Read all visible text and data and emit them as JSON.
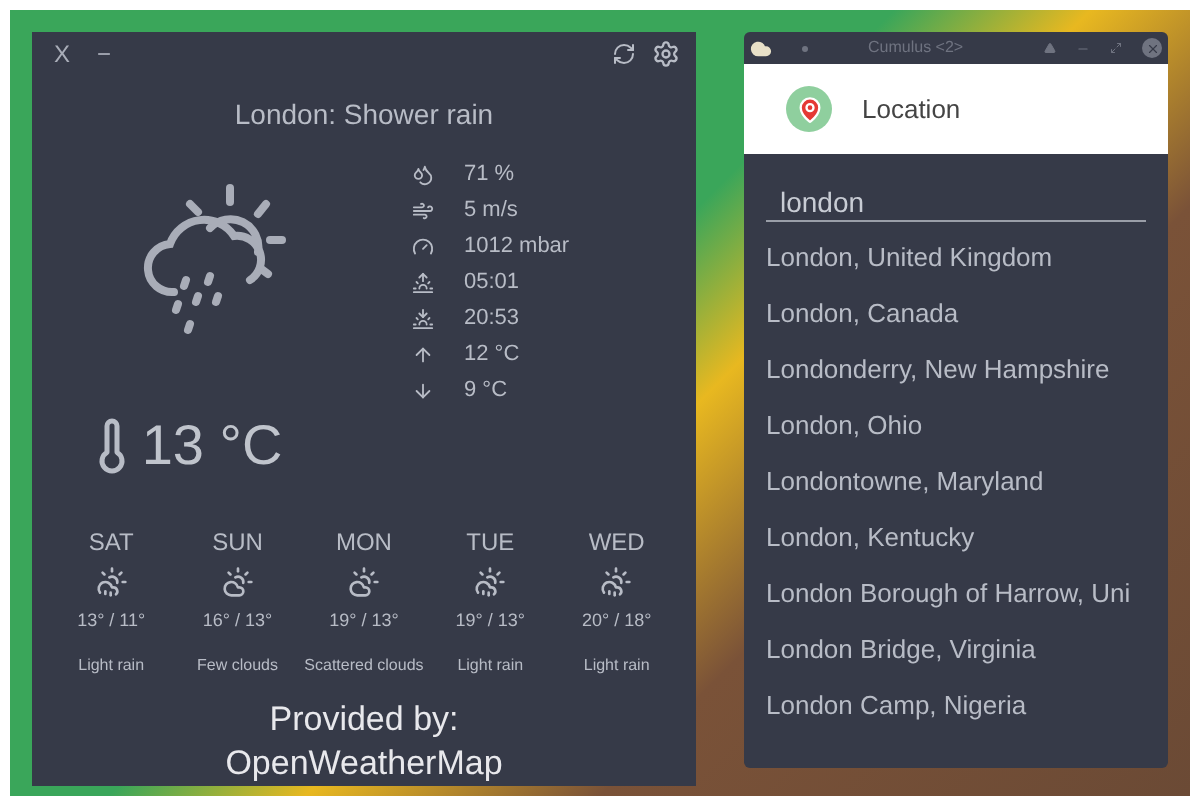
{
  "weather_window": {
    "close_label": "X",
    "minimize_label": "−",
    "title": "London: Shower rain",
    "weather_icon": {
      "kind": "rain"
    },
    "details": [
      {
        "kind": "humidity",
        "value": "71 %"
      },
      {
        "kind": "wind",
        "value": "5 m/s"
      },
      {
        "kind": "pressure",
        "value": "1012 mbar"
      },
      {
        "kind": "sunrise",
        "value": "05:01"
      },
      {
        "kind": "sunset",
        "value": "20:53"
      },
      {
        "kind": "high",
        "value": "12 °C"
      },
      {
        "kind": "low",
        "value": "9 °C"
      }
    ],
    "temperature": "13 °C",
    "forecast": [
      {
        "day": "SAT",
        "kind": "rain",
        "temps": "13° / 11°",
        "description": "Light rain"
      },
      {
        "day": "SUN",
        "kind": "clouds",
        "temps": "16° / 13°",
        "description": "Few clouds"
      },
      {
        "day": "MON",
        "kind": "clouds",
        "temps": "19° / 13°",
        "description": "Scattered clouds"
      },
      {
        "day": "TUE",
        "kind": "rain",
        "temps": "19° / 13°",
        "description": "Light rain"
      },
      {
        "day": "WED",
        "kind": "rain",
        "temps": "20° / 18°",
        "description": "Light rain"
      }
    ],
    "provider": [
      "Provided by:",
      "OpenWeatherMap"
    ]
  },
  "location_window": {
    "title": "Cumulus <2>",
    "header": "Location",
    "search": {
      "value": "london"
    },
    "results": [
      "London, United Kingdom",
      "London, Canada",
      "Londonderry, New Hampshire",
      "London, Ohio",
      "Londontowne, Maryland",
      "London, Kentucky",
      "London Borough of Harrow, Uni",
      "London Bridge, Virginia",
      "London Camp, Nigeria"
    ]
  }
}
